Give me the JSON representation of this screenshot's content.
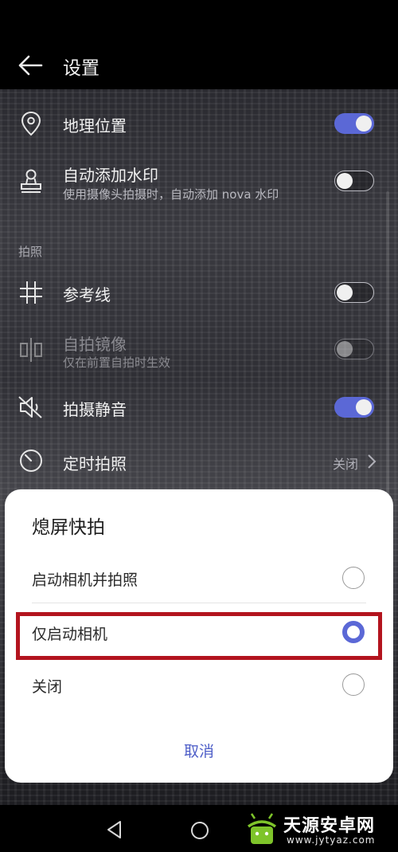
{
  "header": {
    "title": "设置"
  },
  "settings": {
    "location": {
      "label": "地理位置",
      "toggle": "on"
    },
    "watermark": {
      "label": "自动添加水印",
      "sub": "使用摄像头拍摄时，自动添加 nova 水印",
      "toggle": "off"
    },
    "section_photo": "拍照",
    "grid": {
      "label": "参考线",
      "toggle": "off"
    },
    "mirror": {
      "label": "自拍镜像",
      "sub": "仅在前置自拍时生效",
      "toggle": "off",
      "enabled": false
    },
    "mute": {
      "label": "拍摄静音",
      "toggle": "on"
    },
    "timer": {
      "label": "定时拍照",
      "value": "关闭"
    }
  },
  "dialog": {
    "title": "熄屏快拍",
    "options": [
      {
        "label": "启动相机并拍照",
        "selected": false
      },
      {
        "label": "仅启动相机",
        "selected": true
      },
      {
        "label": "关闭",
        "selected": false
      }
    ],
    "cancel_label": "取消"
  },
  "watermark_brand": {
    "title": "天源安卓网",
    "url": "www.jytyaz.com"
  },
  "colors": {
    "accent": "#5b68d6",
    "highlight": "#b3141e",
    "cancel": "#4f5fc8"
  },
  "icons": [
    "back-arrow-icon",
    "location-pin-icon",
    "stamp-icon",
    "grid-icon",
    "mirror-icon",
    "mute-speaker-icon",
    "timer-icon",
    "chevron-right-icon",
    "nav-back-icon",
    "nav-home-icon"
  ]
}
